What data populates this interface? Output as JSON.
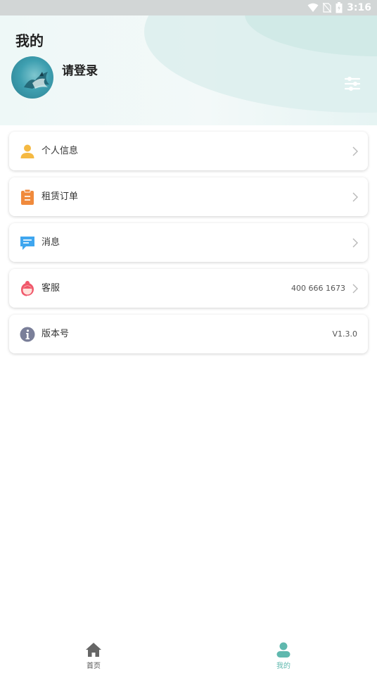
{
  "status_bar": {
    "time": "3:16"
  },
  "header": {
    "title": "我的",
    "login_text": "请登录"
  },
  "menu": [
    {
      "label": "个人信息",
      "value": ""
    },
    {
      "label": "租赁订单",
      "value": ""
    },
    {
      "label": "消息",
      "value": ""
    },
    {
      "label": "客服",
      "value": "400 666 1673"
    },
    {
      "label": "版本号",
      "value": "V1.3.0"
    }
  ],
  "bottom_nav": [
    {
      "label": "首页",
      "active": false
    },
    {
      "label": "我的",
      "active": true
    }
  ],
  "colors": {
    "accent": "#5fb8ae",
    "nav_inactive": "#666666",
    "user_icon": "#f5b942",
    "order_icon": "#f08a3c",
    "message_icon": "#3fa6ef",
    "service_icon": "#f0586b",
    "info_icon": "#7a7f99"
  },
  "icons": [
    "wifi-icon",
    "no-sim-icon",
    "battery-icon",
    "avatar",
    "settings-icon",
    "user-icon",
    "clipboard-icon",
    "message-icon",
    "headset-icon",
    "info-icon",
    "chevron-right-icon",
    "home-icon",
    "profile-icon"
  ]
}
